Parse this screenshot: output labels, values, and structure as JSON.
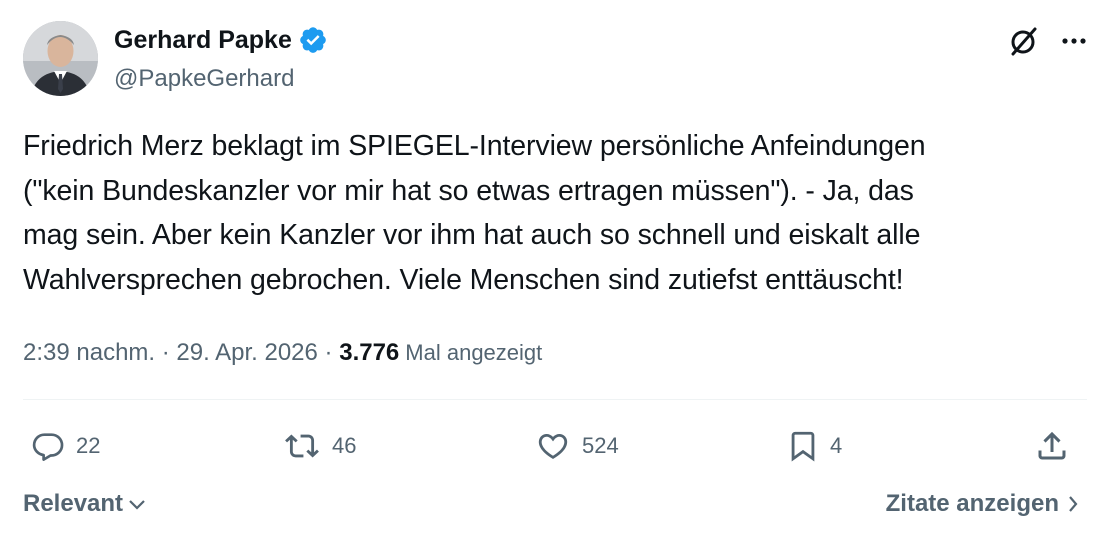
{
  "author": {
    "display_name": "Gerhard Papke",
    "handle": "@PapkeGerhard",
    "verified": true
  },
  "tweet": {
    "text": "Friedrich Merz beklagt im SPIEGEL-Interview persönliche Anfeindungen\n(\"kein Bundeskanzler vor mir hat so etwas ertragen müssen\"). - Ja, das\nmag sein. Aber kein Kanzler vor ihm hat auch so schnell und eiskalt alle\nWahlversprechen gebrochen. Viele Menschen sind zutiefst enttäuscht!",
    "time": "2:39 nachm.",
    "separator": " · ",
    "date": "29. Apr. 2026",
    "views_count": "3.776",
    "views_label": "Mal angezeigt"
  },
  "actions": {
    "replies": "22",
    "reposts": "46",
    "likes": "524",
    "bookmarks": "4"
  },
  "footer": {
    "sort_label": "Relevant",
    "quotes_label": "Zitate anzeigen"
  },
  "colors": {
    "verified_blue": "#1d9bf0",
    "secondary_text": "#536471",
    "primary_text": "#0f1419"
  },
  "icons": {
    "top": [
      "grok-icon",
      "more-icon"
    ],
    "actions": [
      "reply-icon",
      "repost-icon",
      "like-icon",
      "bookmark-icon",
      "share-icon"
    ]
  }
}
